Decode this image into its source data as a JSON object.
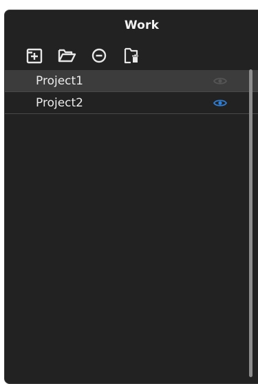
{
  "panel": {
    "title": "Work"
  },
  "toolbar": {
    "buttons": [
      {
        "icon": "new-project-icon"
      },
      {
        "icon": "open-folder-icon"
      },
      {
        "icon": "remove-icon"
      },
      {
        "icon": "delete-file-icon"
      }
    ]
  },
  "projects": [
    {
      "name": "Project1",
      "visible": false,
      "selected": true
    },
    {
      "name": "Project2",
      "visible": true,
      "selected": false
    }
  ],
  "colors": {
    "panel_bg": "#222222",
    "selected_row_bg": "#3c3c3c",
    "eye_active": "#2f7fd8",
    "eye_inactive": "#5a5a5a",
    "text": "#ececec"
  }
}
